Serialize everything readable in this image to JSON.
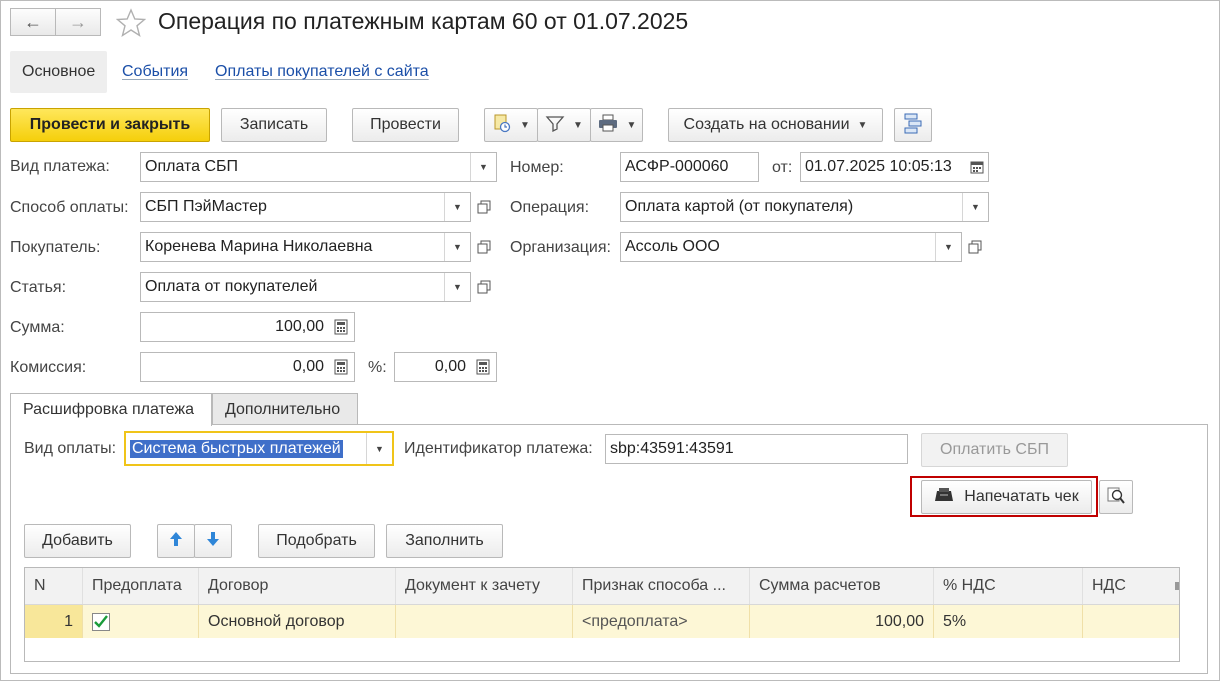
{
  "window": {
    "title": "Операция по платежным картам 60 от 01.07.2025"
  },
  "tabs": [
    {
      "label": "Основное"
    },
    {
      "label": "События"
    },
    {
      "label": "Оплаты покупателей с сайта"
    }
  ],
  "toolbar": {
    "post_close": "Провести и закрыть",
    "save": "Записать",
    "post": "Провести",
    "create_based": "Создать на основании"
  },
  "form": {
    "payment_type": {
      "label": "Вид платежа:",
      "value": "Оплата СБП"
    },
    "payment_method": {
      "label": "Способ оплаты:",
      "value": "СБП ПэйМастер"
    },
    "buyer": {
      "label": "Покупатель:",
      "value": "Коренева Марина Николаевна"
    },
    "article": {
      "label": "Статья:",
      "value": "Оплата от покупателей"
    },
    "amount": {
      "label": "Сумма:",
      "value": "100,00"
    },
    "commission": {
      "label": "Комиссия:",
      "value": "0,00"
    },
    "percent": {
      "label": "%:",
      "value": "0,00"
    },
    "number": {
      "label": "Номер:",
      "value": "АСФР-000060"
    },
    "date": {
      "label": "от:",
      "value": "01.07.2025 10:05:13"
    },
    "operation": {
      "label": "Операция:",
      "value": "Оплата картой (от покупателя)"
    },
    "organization": {
      "label": "Организация:",
      "value": "Ассоль ООО"
    }
  },
  "subtabs": [
    {
      "label": "Расшифровка платежа"
    },
    {
      "label": "Дополнительно"
    }
  ],
  "panel": {
    "pay_kind": {
      "label": "Вид оплаты:",
      "value": "Система быстрых платежей"
    },
    "payment_id": {
      "label": "Идентификатор платежа:",
      "value": "sbp:43591:43591"
    },
    "pay_sbp": "Оплатить СБП",
    "print_receipt": "Напечатать чек",
    "add": "Добавить",
    "pick": "Подобрать",
    "fill": "Заполнить"
  },
  "table": {
    "columns": [
      "N",
      "Предоплата",
      "Договор",
      "Документ к зачету",
      "Признак способа ...",
      "Сумма расчетов",
      "% НДС",
      "НДС"
    ],
    "rows": [
      {
        "n": "1",
        "prepayment": true,
        "contract": "Основной договор",
        "doc": "",
        "sign": "<предоплата>",
        "sum": "100,00",
        "vat_rate": "5%",
        "vat": ""
      }
    ]
  },
  "colors": {
    "primary_button": "#f5cf0b",
    "highlight_box": "#c00000",
    "selection": "#3f6fc9",
    "link": "#1b4fa8",
    "row_selected": "#f8e79a"
  }
}
